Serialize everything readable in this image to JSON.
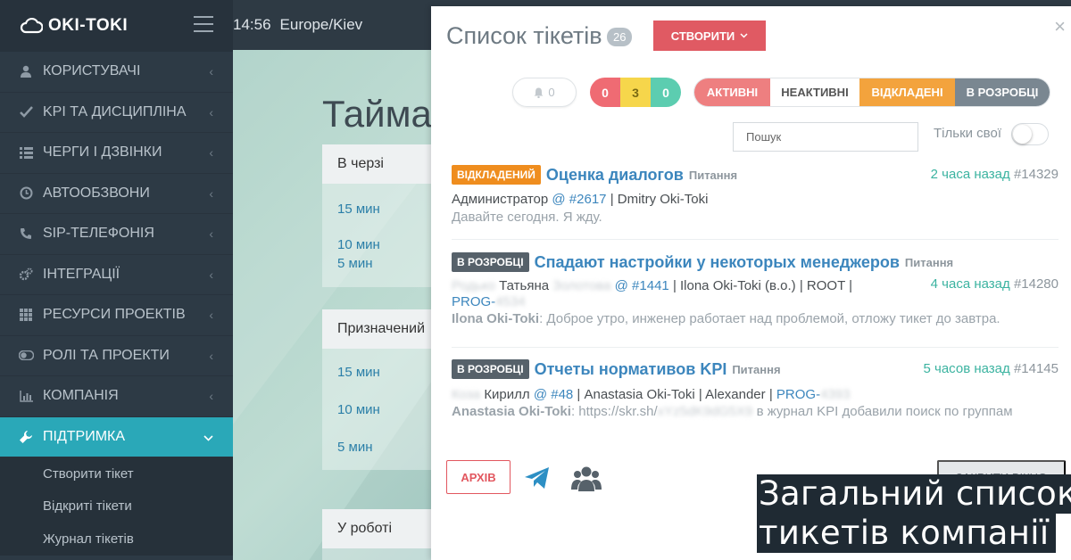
{
  "app": {
    "name": "OKI-TOKI",
    "time": "14:56",
    "timezone": "Europe/Kiev"
  },
  "sidebar": {
    "items": [
      {
        "label": "КОРИСТУВАЧІ",
        "icon": "user-icon"
      },
      {
        "label": "KPI ТА ДИСЦИПЛІНА",
        "icon": "check-icon"
      },
      {
        "label": "ЧЕРГИ І ДЗВІНКИ",
        "icon": "list-icon"
      },
      {
        "label": "АВТООБЗВОНИ",
        "icon": "clock-icon"
      },
      {
        "label": "SIP-ТЕЛЕФОНІЯ",
        "icon": "phone-icon"
      },
      {
        "label": "ІНТЕГРАЦІЇ",
        "icon": "gears-icon"
      },
      {
        "label": "РЕСУРСИ ПРОЕКТІВ",
        "icon": "grid-icon"
      },
      {
        "label": "РОЛІ ТА ПРОЕКТИ",
        "icon": "toggle-icon"
      },
      {
        "label": "КОМПАНІЯ",
        "icon": "bar-chart-icon"
      },
      {
        "label": "ПІДТРИМКА",
        "icon": "wrench-icon"
      }
    ],
    "submenu": [
      "Створити тікет",
      "Відкриті тікети",
      "Журнал тікетів"
    ]
  },
  "background": {
    "title": "Таймау",
    "cards": [
      {
        "header": "В черзі",
        "lines": [
          "15 мин",
          "10 мин",
          "5 мин"
        ]
      },
      {
        "header": "Призначений",
        "lines": [
          "15 мин",
          "10 мин",
          "5 мин"
        ]
      },
      {
        "header": "У роботі",
        "lines": []
      }
    ]
  },
  "modal": {
    "title": "Список тікетів",
    "count": "26",
    "create_label": "СТВОРИТИ",
    "close_symbol": "×",
    "bell_count": "0",
    "status_counts": [
      "0",
      "3",
      "0"
    ],
    "filters": [
      "АКТИВНІ",
      "НЕАКТИВНІ",
      "ВІДКЛАДЕНІ",
      "В РОЗРОБЦІ"
    ],
    "search_placeholder": "Пошук",
    "own_only_label": "Тільки свої",
    "archive_label": "АРХІВ",
    "close_window_label": "ЗАКРИТИ ВІКНО",
    "tickets": [
      {
        "badge": "ВІДКЛАДЕНИЙ",
        "title": "Оценка диалогов",
        "category": "Питання",
        "time": "2 часа назад",
        "id": "#14329",
        "line1_prefix": "Администратор",
        "line1_link": "@ #2617",
        "line1_suffix": "| Dmitry Oki-Toki",
        "line2": "Давайте сегодня. Я жду."
      },
      {
        "badge": "В РОЗРОБЦІ",
        "title": "Спадают настройки у некоторых менеджеров",
        "category": "Питання",
        "time": "4 часа назад",
        "id": "#14280",
        "line1_name": "Татьяна",
        "line1_link": "@ #1441",
        "line1_suffix": "| Ilona Oki-Toki (в.о.) | ROOT |",
        "line1_prog": "PROG-",
        "line2_author": "Ilona Oki-Toki",
        "line2": ": Доброе утро, инженер работает над проблемой, отложу тикет до завтра."
      },
      {
        "badge": "В РОЗРОБЦІ",
        "title": "Отчеты нормативов KPI",
        "category": "Питання",
        "time": "5 часов назад",
        "id": "#14145",
        "line1_name": "Кирилл",
        "line1_link": "@ #48",
        "line1_suffix": "| Anastasia Oki-Toki | Alexander |",
        "line1_prog": "PROG-",
        "line2_author": "Anastasia Oki-Toki",
        "line2_start": ": https://skr.sh/",
        "line2": "в журнал KPI добавили поиск по группам"
      }
    ]
  },
  "caption": {
    "line1": "Загальний список",
    "line2": "тикетів компанії"
  }
}
